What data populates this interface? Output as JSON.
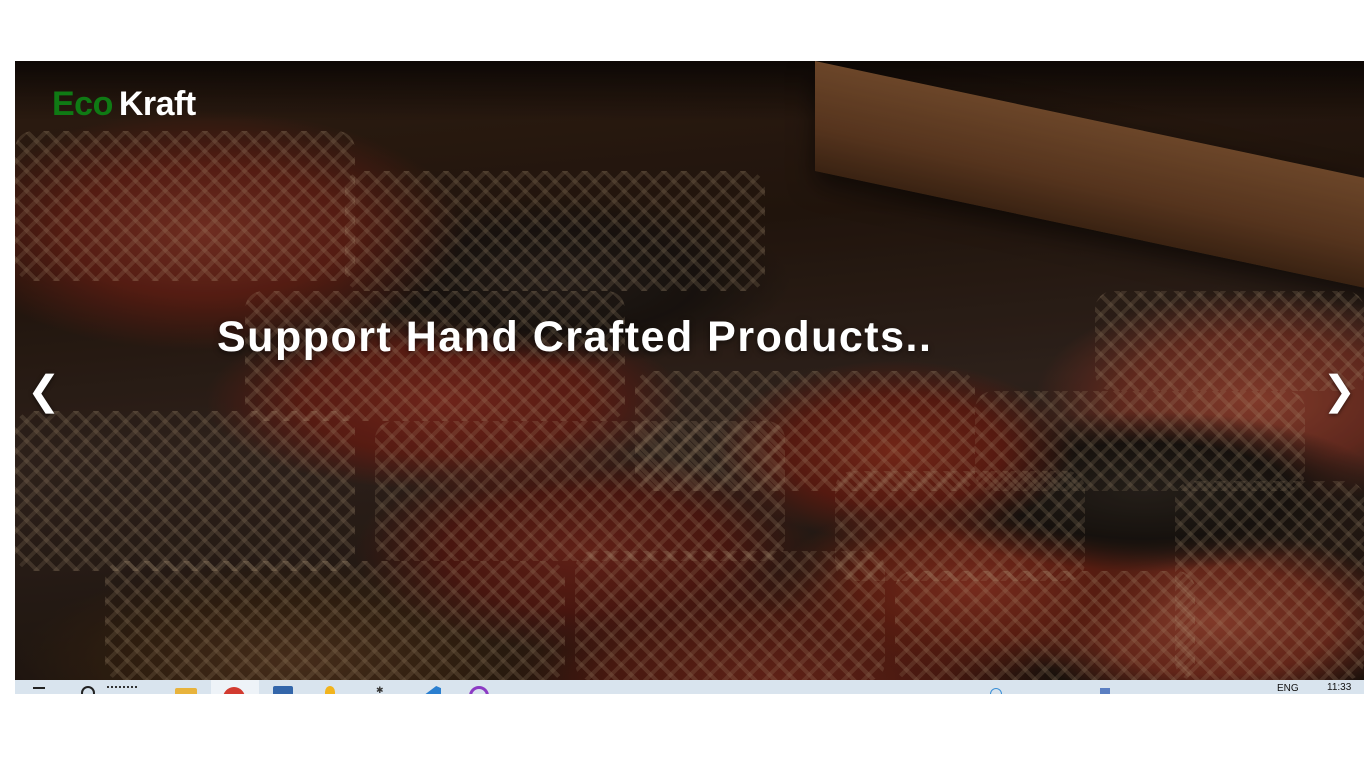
{
  "brand": {
    "eco": "Eco",
    "kraft": "Kraft",
    "eco_color": "#0f7a14",
    "kraft_color": "#ffffff"
  },
  "hero": {
    "headline": "Support Hand Crafted Products..",
    "prev_arrow": "❮",
    "next_arrow": "❯",
    "prev_icon": "chevron-left-icon",
    "next_icon": "chevron-right-icon"
  },
  "taskbar": {
    "language": "ENG",
    "time": "11:33"
  }
}
